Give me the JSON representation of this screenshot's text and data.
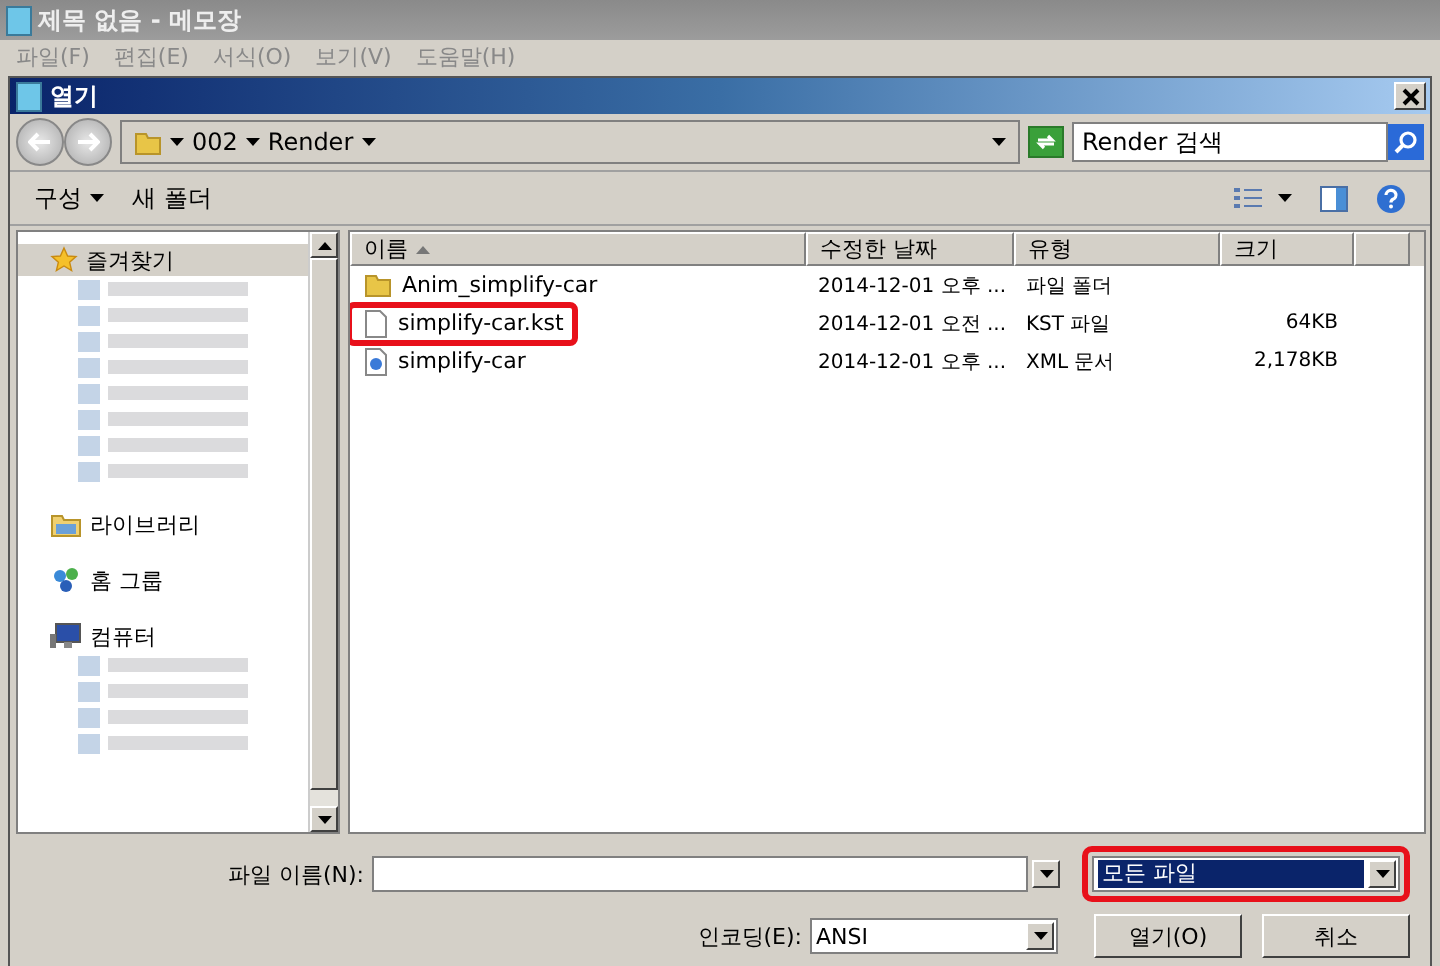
{
  "notepad": {
    "title": "제목 없음 - 메모장",
    "menu": [
      "파일(F)",
      "편집(E)",
      "서식(O)",
      "보기(V)",
      "도움말(H)"
    ]
  },
  "dialog": {
    "title": "열기",
    "breadcrumb": [
      "002",
      "Render"
    ],
    "search": {
      "placeholder": "Render 검색"
    }
  },
  "toolbar": [
    {
      "label": "구성",
      "dropdown": true
    },
    {
      "label": "새 폴더",
      "dropdown": false
    }
  ],
  "sidebar": [
    {
      "kind": "favorites",
      "label": "즐겨찾기",
      "selected": true,
      "children": [
        {
          "kind": "blurred"
        },
        {
          "kind": "blurred"
        },
        {
          "kind": "blurred"
        },
        {
          "kind": "blurred"
        },
        {
          "kind": "blurred"
        },
        {
          "kind": "blurred"
        },
        {
          "kind": "blurred"
        },
        {
          "kind": "blurred"
        }
      ]
    },
    {
      "kind": "library",
      "label": "라이브러리",
      "selected": false
    },
    {
      "kind": "homegroup",
      "label": "홈 그룹",
      "selected": false
    },
    {
      "kind": "computer",
      "label": "컴퓨터",
      "selected": false,
      "children": [
        {
          "kind": "blurred"
        },
        {
          "kind": "blurred"
        },
        {
          "kind": "blurred"
        },
        {
          "kind": "blurred"
        }
      ]
    }
  ],
  "columns": [
    {
      "label": "이름",
      "sorted": true
    },
    {
      "label": "수정한 날짜"
    },
    {
      "label": "유형"
    },
    {
      "label": "크기"
    }
  ],
  "rows": [
    {
      "kind": "folder",
      "name": "Anim_simplify-car",
      "date": "2014-12-01 오후 ...",
      "type": "파일 폴더",
      "highlighted": false
    },
    {
      "kind": "file",
      "name": "simplify-car.kst",
      "date": "2014-12-01 오전 ...",
      "type": "KST 파일",
      "size": "64KB",
      "highlighted": true
    },
    {
      "kind": "xml",
      "name": "simplify-car",
      "date": "2014-12-01 오후 ...",
      "type": "XML 문서",
      "size": "2,178KB",
      "highlighted": false
    }
  ],
  "bottom": {
    "filename_label": "파일 이름(N):",
    "filetype": {
      "value": "모든 파일",
      "highlighted": true
    },
    "encoding_label": "인코딩(E):",
    "encoding": "ANSI",
    "buttons": [
      "열기(O)",
      "취소"
    ]
  }
}
